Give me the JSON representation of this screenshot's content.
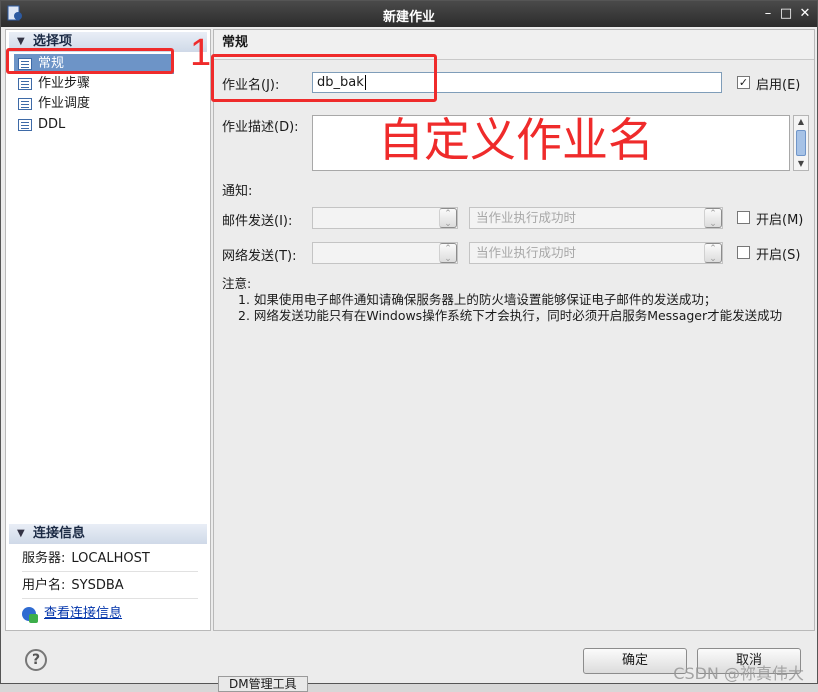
{
  "window": {
    "title": "新建作业"
  },
  "left": {
    "options_header": "选择项",
    "nav": [
      {
        "label": "常规",
        "selected": true
      },
      {
        "label": "作业步骤",
        "selected": false
      },
      {
        "label": "作业调度",
        "selected": false
      },
      {
        "label": "DDL",
        "selected": false
      }
    ],
    "conn_header": "连接信息",
    "server_label": "服务器:",
    "server_value": "LOCALHOST",
    "user_label": "用户名:",
    "user_value": "SYSDBA",
    "view_conn_link": "查看连接信息"
  },
  "right": {
    "header": "常规",
    "job_name_label": "作业名(J):",
    "job_name_value": "db_bak",
    "enable_label": "启用(E)",
    "enable_checked": true,
    "desc_label": "作业描述(D):",
    "notify_label": "通知:",
    "mail_label": "邮件发送(I):",
    "mail_condition": "当作业执行成功时",
    "mail_enable_label": "开启(M)",
    "net_label": "网络发送(T):",
    "net_condition": "当作业执行成功时",
    "net_enable_label": "开启(S)",
    "note_title": "注意:",
    "note_lines": [
      "1. 如果使用电子邮件通知请确保服务器上的防火墙设置能够保证电子邮件的发送成功；",
      "2. 网络发送功能只有在Windows操作系统下才会执行，同时必须开启服务Messager才能发送成功"
    ]
  },
  "buttons": {
    "ok": "确定",
    "cancel": "取消",
    "help": "?"
  },
  "annotations": {
    "step": "1",
    "caption": "自定义作业名"
  },
  "taskbar": {
    "tab": "DM管理工具"
  },
  "watermark": "CSDN @祢真伟大",
  "colors": {
    "selection": "#6d94c7",
    "annotation": "#ef2b2b"
  }
}
